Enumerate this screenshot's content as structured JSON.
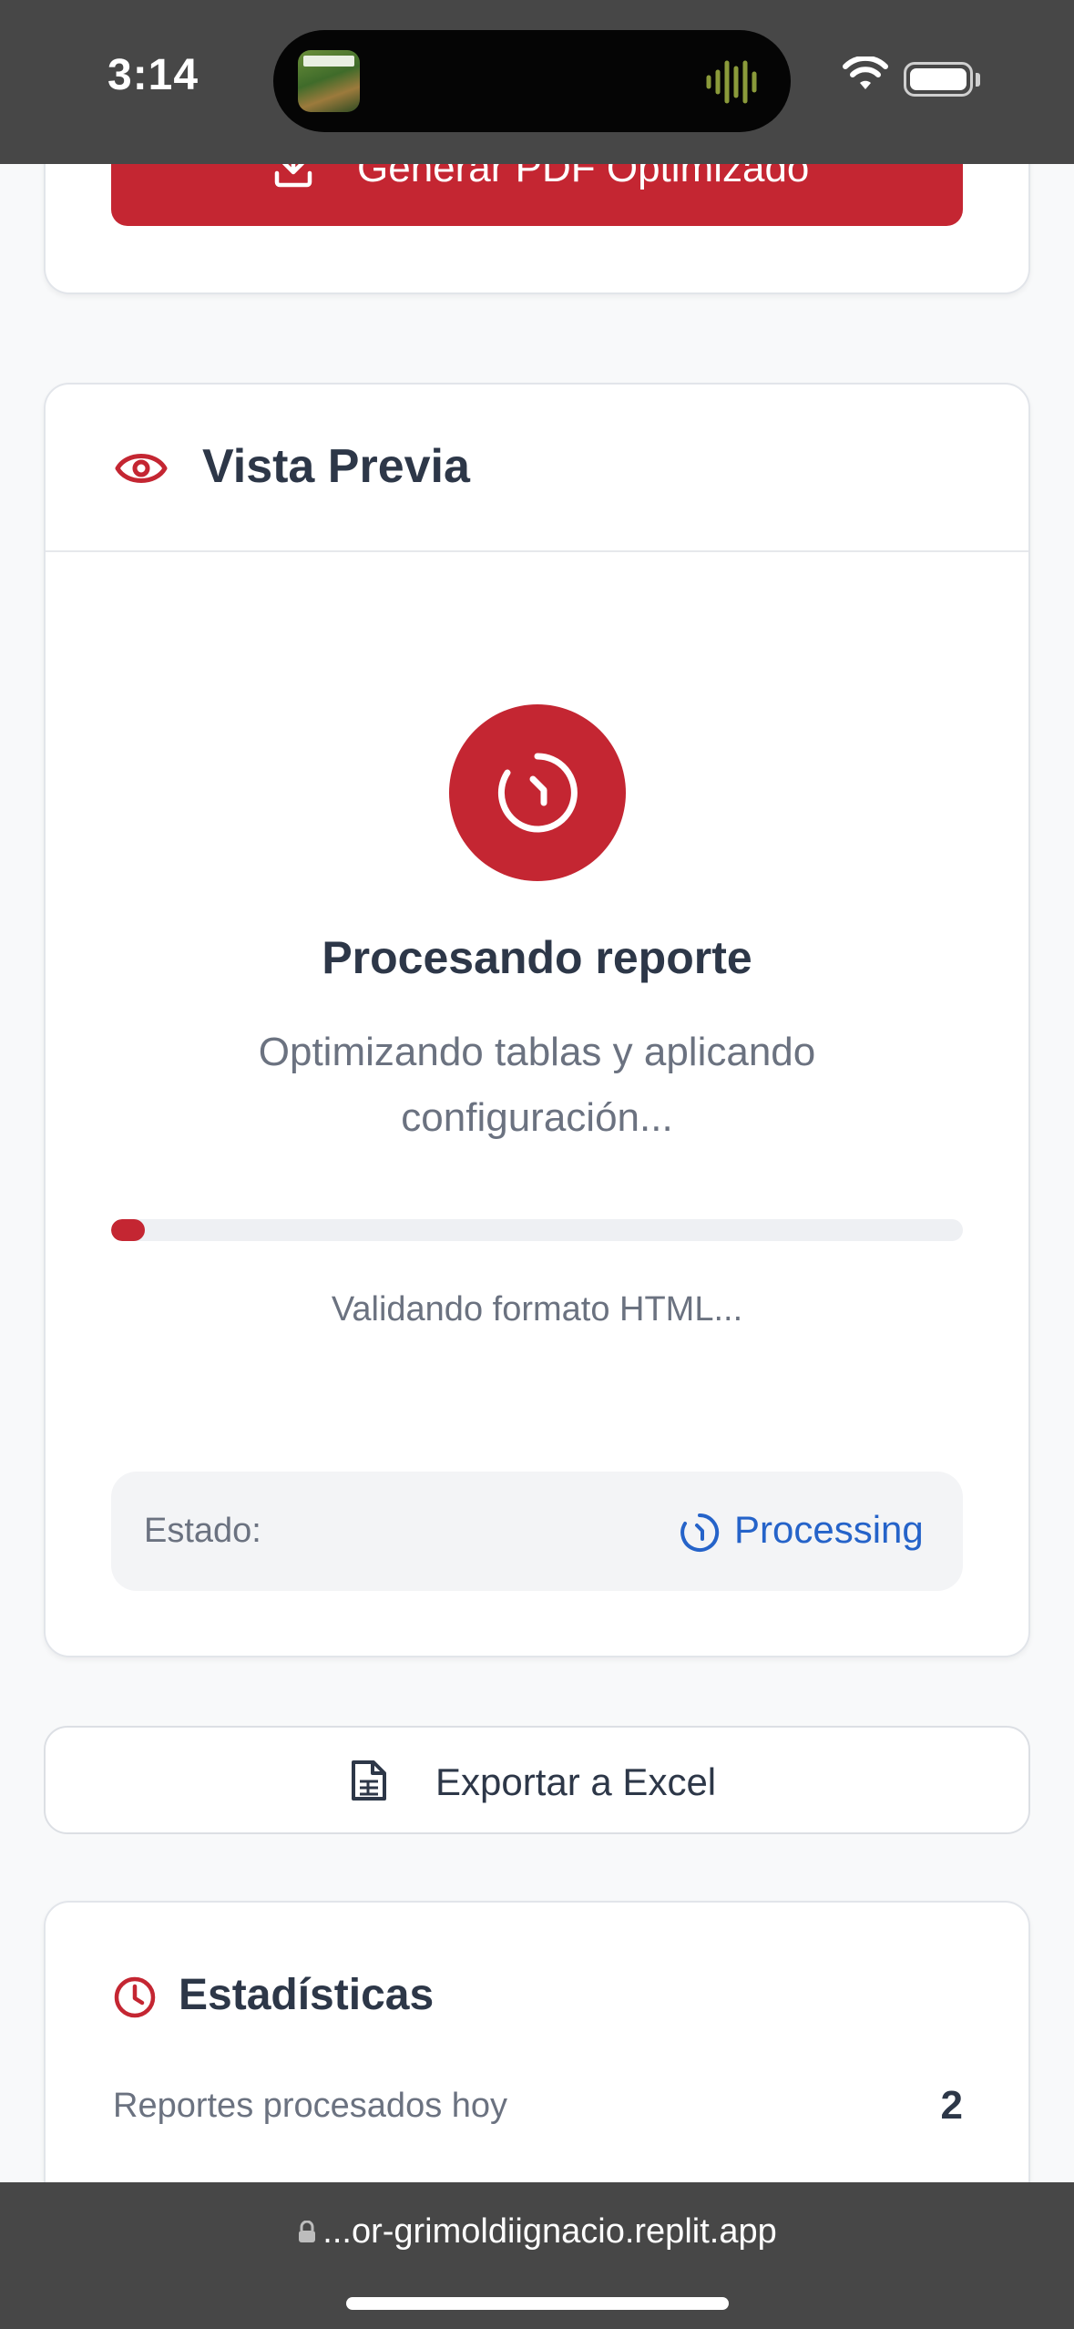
{
  "status_bar": {
    "time": "3:14",
    "activity_icon": "waveform-icon",
    "wifi_icon": "wifi-icon",
    "battery_icon": "battery-icon"
  },
  "pdf_button": {
    "label": "Generar PDF Optimizado",
    "icon": "download-icon"
  },
  "preview": {
    "title": "Vista Previa",
    "icon": "eye-icon",
    "processing_title": "Procesando reporte",
    "processing_desc_line1": "Optimizando tablas y aplicando",
    "processing_desc_line2": "configuración...",
    "progress_fraction": 0.04,
    "step_text": "Validando formato HTML...",
    "status_label": "Estado:",
    "status_value": "Processing"
  },
  "excel_button": {
    "label": "Exportar a Excel",
    "icon": "spreadsheet-file-icon"
  },
  "stats": {
    "title": "Estadísticas",
    "icon": "clock-icon",
    "rows": [
      {
        "label": "Reportes procesados hoy",
        "value": "2"
      }
    ]
  },
  "browser": {
    "url": "...or-grimoldiignacio.replit.app"
  },
  "colors": {
    "brand_red": "#c42632",
    "status_blue": "#2563c9",
    "text_dark": "#2d3748",
    "text_muted": "#6b7280"
  }
}
